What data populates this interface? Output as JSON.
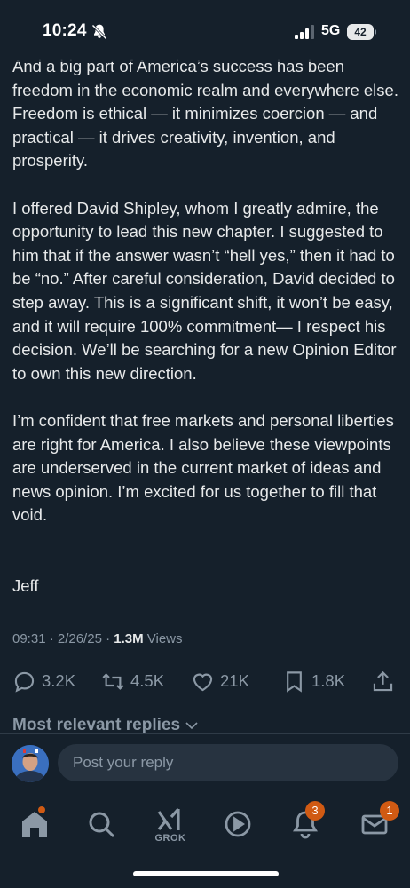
{
  "status_bar": {
    "time": "10:24",
    "network": "5G",
    "battery": "42"
  },
  "post": {
    "paragraphs": [
      "And a big part of America’s success has been freedom in the economic realm and everywhere else. Freedom is ethical — it minimizes coercion — and practical — it drives creativity, invention, and prosperity.",
      "I offered David Shipley, whom I greatly admire, the opportunity to lead this new chapter. I suggested to him that if the answer wasn’t “hell yes,” then it had to be “no.” After careful consideration, David decided to step away. This is a significant shift, it won’t be easy, and it will require 100% commitment— I respect his decision. We’ll be searching for a new Opinion Editor to own this new direction.",
      "I’m confident that free markets and personal liberties are right for America. I also believe these viewpoints are underserved in the current market of ideas and news opinion. I’m excited for us together to fill that void."
    ],
    "signature": "Jeff",
    "timestamp": "09:31 · 2/26/25 · ",
    "views_count": "1.3M",
    "views_label": " Views"
  },
  "actions": {
    "replies": "3.2K",
    "reposts": "4.5K",
    "likes": "21K",
    "bookmarks": "1.8K"
  },
  "replies_filter": "Most relevant replies",
  "reply_box": {
    "placeholder": "Post your reply"
  },
  "bottom_nav": {
    "grok_label": "GROK",
    "notifications_badge": "3",
    "messages_badge": "1"
  },
  "colors": {
    "background": "#15202b",
    "text": "#e7e9ea",
    "muted": "#8b98a5",
    "badge": "#d05a13"
  }
}
